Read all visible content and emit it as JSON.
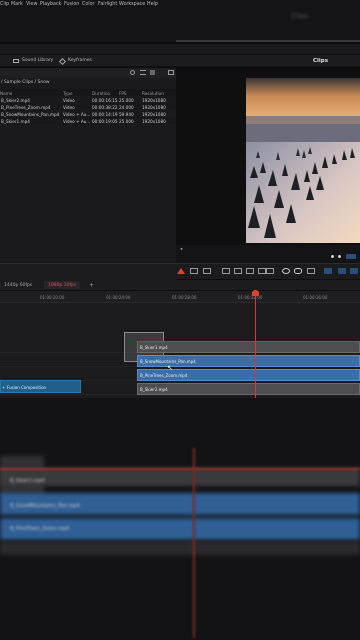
{
  "topbar": {
    "title": "Clips"
  },
  "menu": {
    "items": [
      "Clip",
      "Mark",
      "View",
      "Playback",
      "Fusion",
      "Color",
      "Fairlight",
      "Workspace",
      "Help"
    ]
  },
  "toolbar": {
    "sound_library": "Sound Library",
    "keyframes": "Keyframes",
    "clips_title": "Clips",
    "zoom": "45%",
    "timecode": "00:00:45:05"
  },
  "pool": {
    "breadcrumb": "/ Sample Clips / Snow",
    "columns": [
      "Name",
      "Type",
      "Duration",
      "FPS",
      "Resolution"
    ],
    "rows": [
      [
        "B_Skier2.mp4",
        "Video",
        "00:00:16:15",
        "25.000",
        "1920x1080"
      ],
      [
        "B_PineTrees_Zoom.mp4",
        "Video",
        "00:00:38:22",
        "24.000",
        "1920x1080"
      ],
      [
        "B_SnowMountains_Pan.mp4",
        "Video + Au...",
        "00:00:14:19",
        "59.940",
        "1920x1080"
      ],
      [
        "B_Skier1.mp4",
        "Video + Au...",
        "00:00:19:05",
        "25.000",
        "1920x1080"
      ]
    ]
  },
  "timeline": {
    "tab1": "1440p 60fps",
    "tab2": "1080p 30fps",
    "add": "+",
    "timecodes": [
      "01:00:20:00",
      "01:00:24:00",
      "01:00:28:00",
      "01:00:32:00",
      "01:00:36:00"
    ],
    "clips": {
      "skier1": "B_Skier1.mp4",
      "snow_pan": "B_SnowMountains_Pan.mp4",
      "pine_zoom": "B_PineTrees_Zoom.mp4",
      "skier2": "B_Skier2.mp4",
      "fusion": "Fusion Composition"
    }
  },
  "blurred": {
    "clip1": "B_Skier1.mp4",
    "clip2": "B_SnowMountains_Pan.mp4",
    "clip3": "B_PineTrees_Zoom.mp4"
  },
  "colors": {
    "accent_red": "#d63a2a",
    "clip_blue": "#3b6ea8",
    "fusion_blue": "#1f5f8a"
  }
}
